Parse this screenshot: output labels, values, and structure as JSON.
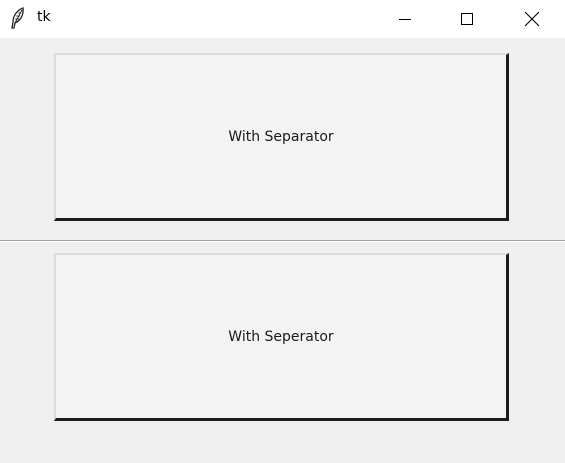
{
  "window": {
    "title": "tk",
    "icon": "feather-icon"
  },
  "controls": {
    "minimize_icon": "minimize-icon",
    "maximize_icon": "maximize-icon",
    "close_icon": "close-icon"
  },
  "buttons": {
    "top_label": "With Separator",
    "bottom_label": "With Seperator"
  },
  "colors": {
    "titlebar": "#ffffff",
    "window_bg": "#f0f0f0",
    "button_bg": "#f3f3f3",
    "button_shadow": "#1c1c1c",
    "separator": "#a0a0a0"
  }
}
